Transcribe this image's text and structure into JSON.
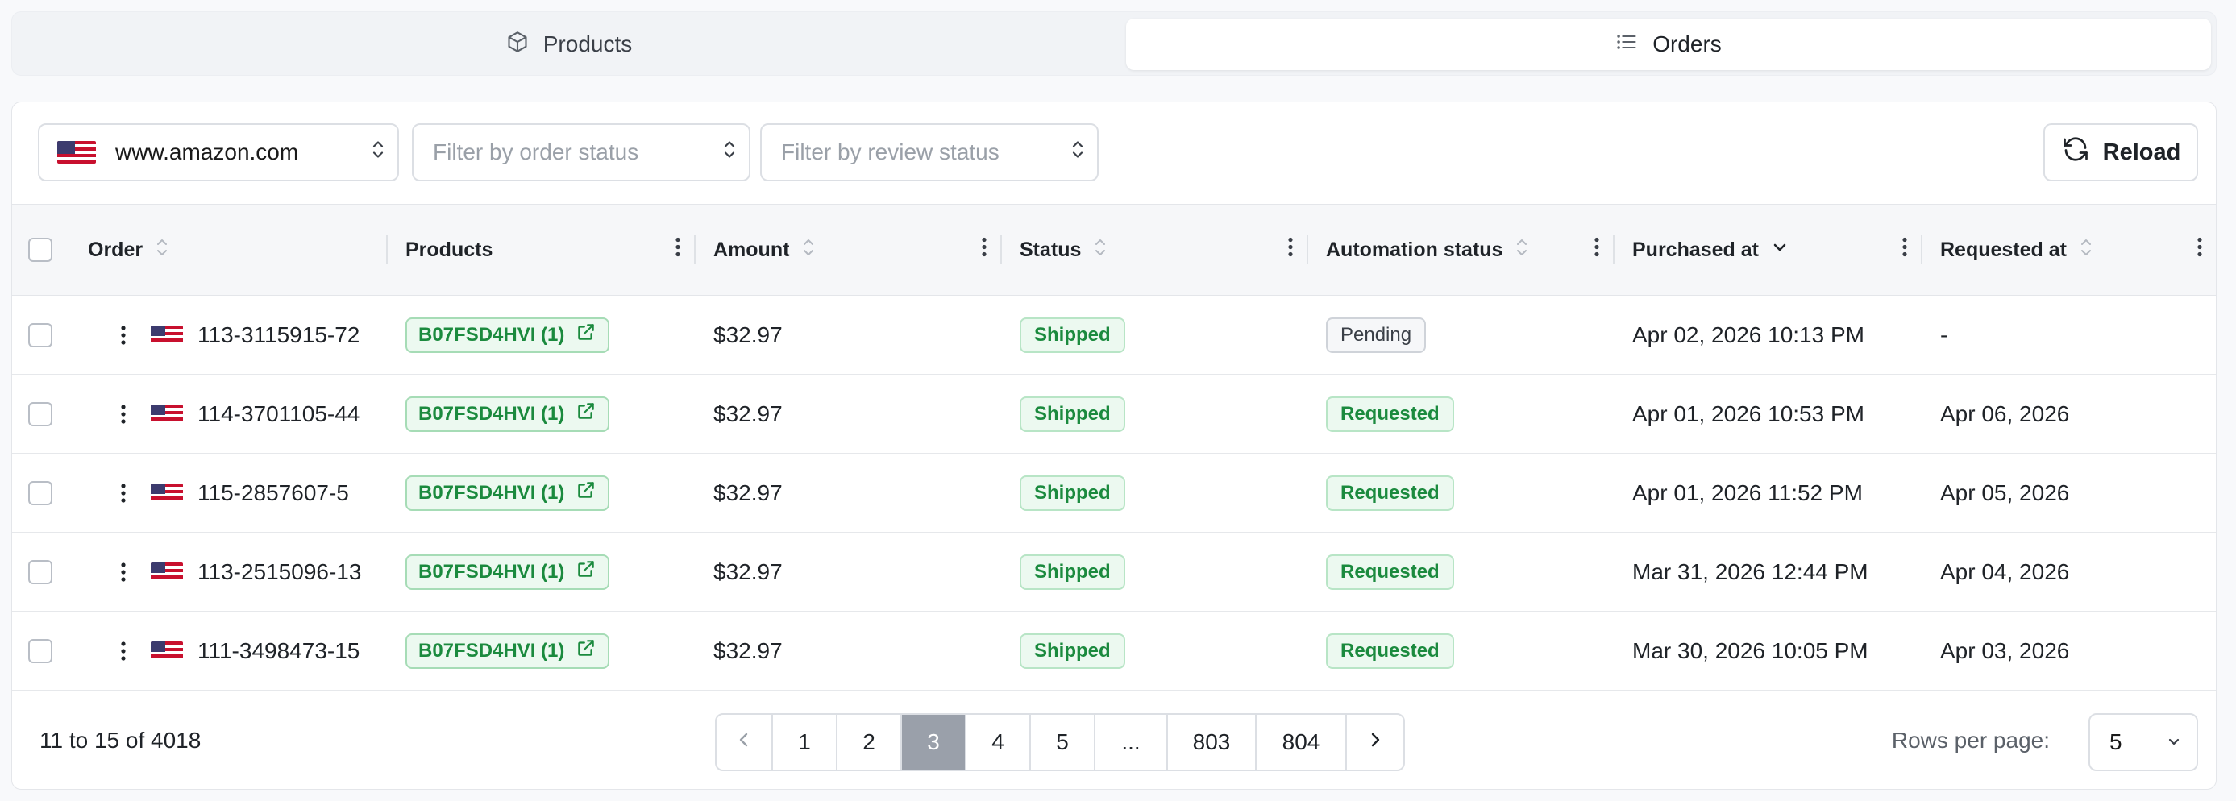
{
  "tabs": {
    "products": "Products",
    "orders": "Orders"
  },
  "toolbar": {
    "marketplace_value": "www.amazon.com",
    "order_status_placeholder": "Filter by order status",
    "review_status_placeholder": "Filter by review status",
    "reload_label": "Reload"
  },
  "table": {
    "headers": {
      "order": "Order",
      "products": "Products",
      "amount": "Amount",
      "status": "Status",
      "automation_status": "Automation status",
      "purchased_at": "Purchased at",
      "requested_at": "Requested at"
    },
    "rows": [
      {
        "order": "113-3115915-72",
        "product": "B07FSD4HVI (1)",
        "amount": "$32.97",
        "status": "Shipped",
        "automation": "Pending",
        "purchased": "Apr 02, 2026 10:13 PM",
        "requested": "-"
      },
      {
        "order": "114-3701105-44",
        "product": "B07FSD4HVI (1)",
        "amount": "$32.97",
        "status": "Shipped",
        "automation": "Requested",
        "purchased": "Apr 01, 2026 10:53 PM",
        "requested": "Apr 06, 2026"
      },
      {
        "order": "115-2857607-5",
        "product": "B07FSD4HVI (1)",
        "amount": "$32.97",
        "status": "Shipped",
        "automation": "Requested",
        "purchased": "Apr 01, 2026 11:52 PM",
        "requested": "Apr 05, 2026"
      },
      {
        "order": "113-2515096-13",
        "product": "B07FSD4HVI (1)",
        "amount": "$32.97",
        "status": "Shipped",
        "automation": "Requested",
        "purchased": "Mar 31, 2026 12:44 PM",
        "requested": "Apr 04, 2026"
      },
      {
        "order": "111-3498473-15",
        "product": "B07FSD4HVI (1)",
        "amount": "$32.97",
        "status": "Shipped",
        "automation": "Requested",
        "purchased": "Mar 30, 2026 10:05 PM",
        "requested": "Apr 03, 2026"
      }
    ]
  },
  "pagination": {
    "range_text": "11 to 15 of 4018",
    "pages": [
      "1",
      "2",
      "3",
      "4",
      "5",
      "...",
      "803",
      "804"
    ],
    "current_page": "3",
    "rows_per_page_label": "Rows per page:",
    "rows_per_page_value": "5"
  },
  "colors": {
    "accent_green": "#1b8a3e",
    "active_page": "#9aa0aa"
  }
}
